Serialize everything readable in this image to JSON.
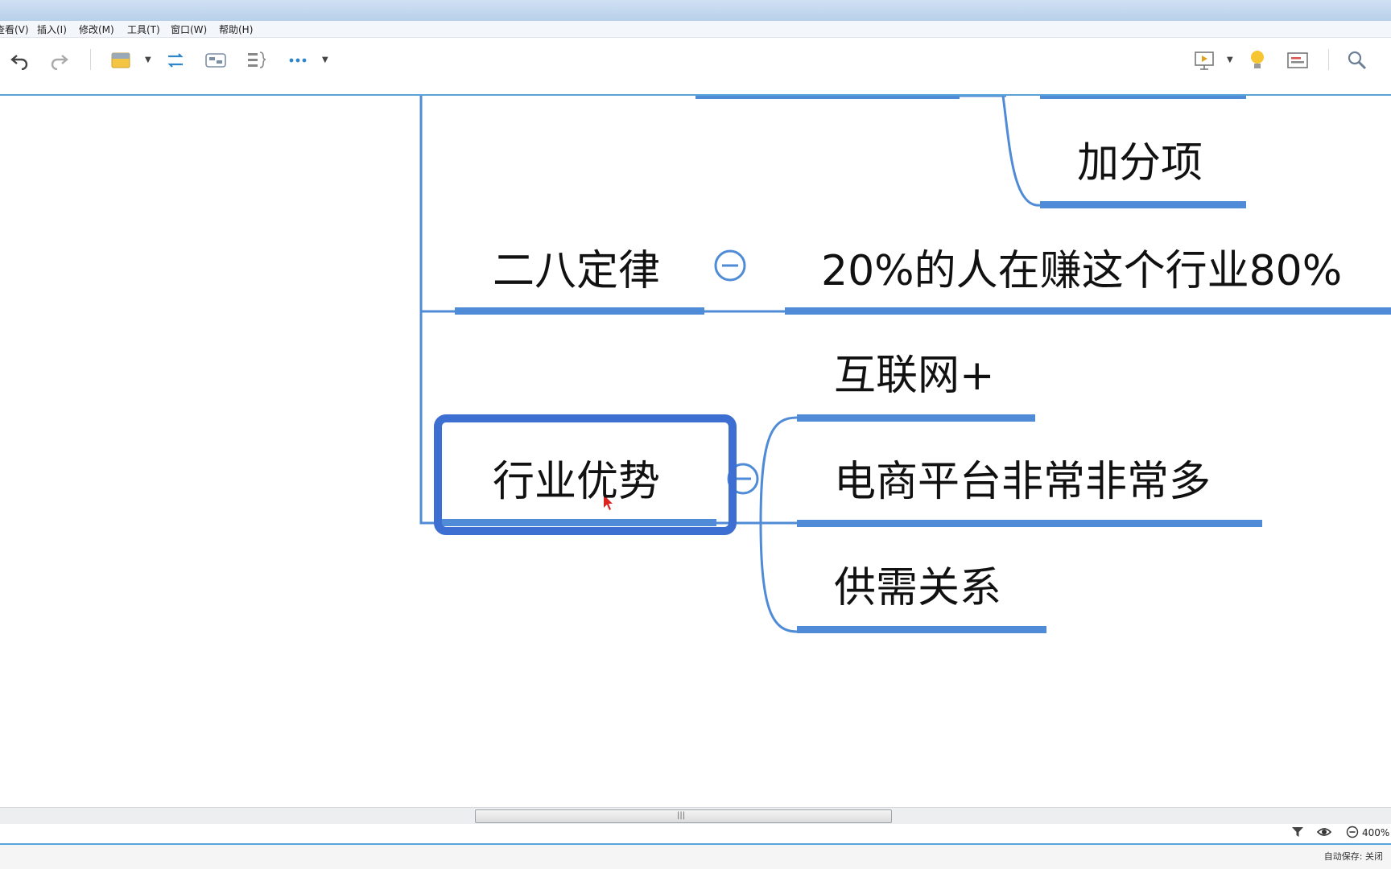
{
  "menu": {
    "items": [
      "查看(V)",
      "插入(I)",
      "修改(M)",
      "工具(T)",
      "窗口(W)",
      "帮助(H)"
    ]
  },
  "toolbar": {
    "icons": [
      "undo-icon",
      "redo-icon",
      "save-icon",
      "relationship-icon",
      "boundary-icon",
      "summary-icon",
      "more-icon",
      "presentation-icon",
      "idea-icon",
      "outline-icon",
      "search-icon"
    ]
  },
  "mindmap": {
    "top_child": "加分项",
    "topic_rule": "二八定律",
    "rule_detail": "20%的人在赚这个行业80%",
    "topic_advantage": "行业优势",
    "advantage_children": [
      "互联网+",
      "电商平台非常非常多",
      "供需关系"
    ]
  },
  "status": {
    "zoom": "400%",
    "autosave": "自动保存: 关闭"
  },
  "colors": {
    "branch": "#4f8bd6",
    "selection": "#3c6fd1",
    "accent": "#5aa3d8"
  }
}
